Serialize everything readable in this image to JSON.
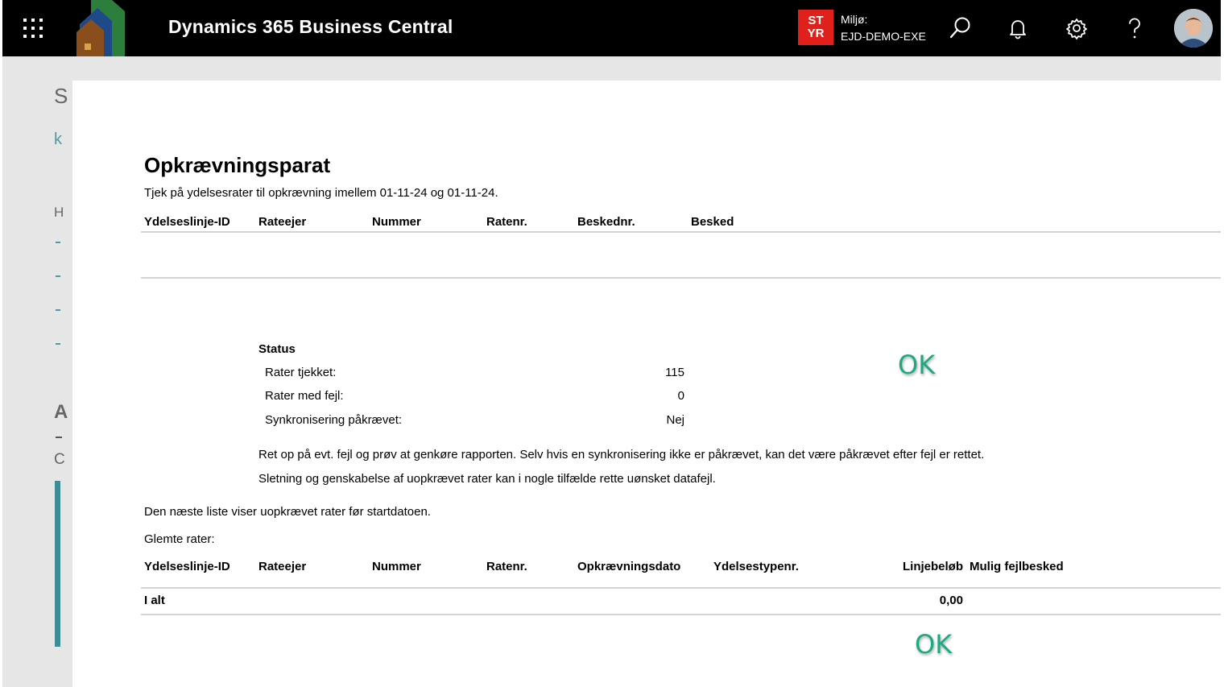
{
  "header": {
    "app_title": "Dynamics 365 Business Central",
    "environment": {
      "badge_line1": "ST",
      "badge_line2": "YR",
      "label": "Miljø:",
      "name": "EJD-DEMO-EXE",
      "badge_color": "#e1201c"
    },
    "icons": [
      "waffle-icon",
      "search-icon",
      "bell-icon",
      "gear-icon",
      "help-icon",
      "avatar"
    ]
  },
  "report": {
    "title": "Opkrævningsparat",
    "subtitle": "Tjek på ydelsesrater til opkrævning imellem 01-11-24 og 01-11-24.",
    "table1_headers": [
      "Ydelseslinje-ID",
      "Rateejer",
      "Nummer",
      "Ratenr.",
      "Beskednr.",
      "Besked"
    ],
    "status": {
      "heading": "Status",
      "rows": [
        {
          "label": "Rater tjekket:",
          "value": "115"
        },
        {
          "label": "Rater med fejl:",
          "value": "0"
        },
        {
          "label": "Synkronisering påkrævet:",
          "value": "Nej"
        }
      ],
      "ok_label": "OK"
    },
    "notes": [
      "Ret op på evt. fejl og prøv at genkøre rapporten. Selv hvis en synkronisering ikke er påkrævet, kan det være påkrævet efter fejl er rettet.",
      "Sletning og genskabelse af uopkrævet rater kan i nogle tilfælde rette uønsket datafejl."
    ],
    "list_intro": "Den næste liste viser uopkrævet rater før startdatoen.",
    "forgotten_label": "Glemte rater:",
    "table2_headers": [
      "Ydelseslinje-ID",
      "Rateejer",
      "Nummer",
      "Ratenr.",
      "Opkrævningsdato",
      "Ydelsestypenr.",
      "Linjebeløb",
      "Mulig fejlbesked"
    ],
    "total": {
      "label": "I alt",
      "amount": "0,00"
    },
    "bottom_ok_label": "OK",
    "ok_color": "#21a883"
  }
}
